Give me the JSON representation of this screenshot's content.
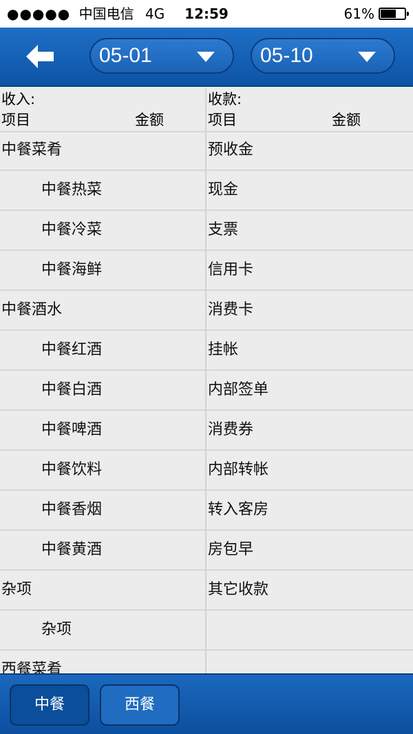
{
  "status_bar": {
    "signal": "●●●●●",
    "carrier": "中国电信",
    "network": "4G",
    "time": "12:59",
    "battery": "61%",
    "battery_level": 0.61
  },
  "header": {
    "back_icon": "left-arrow-icon",
    "start_date": "05-01",
    "end_date": "05-10",
    "caret_icon": "chevron-down-icon"
  },
  "table": {
    "income_title": "收入:",
    "payment_title": "收款:",
    "income_item_header": "项目",
    "income_amount_header": "金额",
    "payment_item_header": "项目",
    "payment_amount_header": "金额",
    "rows": [
      {
        "left": "中餐菜肴",
        "right": "预收金"
      },
      {
        "left": "中餐热菜",
        "right": "现金"
      },
      {
        "left": "中餐冷菜",
        "right": "支票"
      },
      {
        "left": "中餐海鲜",
        "right": "信用卡"
      },
      {
        "left": "中餐酒水",
        "right": "消费卡"
      },
      {
        "left": "中餐红酒",
        "right": "挂帐"
      },
      {
        "left": "中餐白酒",
        "right": "内部签单"
      },
      {
        "left": "中餐啤酒",
        "right": "消费券"
      },
      {
        "left": "中餐饮料",
        "right": "内部转帐"
      },
      {
        "left": "中餐香烟",
        "right": "转入客房"
      },
      {
        "left": "中餐黄酒",
        "right": "房包早"
      },
      {
        "left": "杂项",
        "right": "其它收款"
      },
      {
        "left": "杂项",
        "right": ""
      },
      {
        "left": "西餐菜肴",
        "right": ""
      }
    ]
  },
  "tabbar": {
    "tab1_label": "中餐",
    "tab2_label": "西餐"
  },
  "colors": {
    "header_blue": "#1565c0",
    "active_tab": "#0a4e9c"
  }
}
